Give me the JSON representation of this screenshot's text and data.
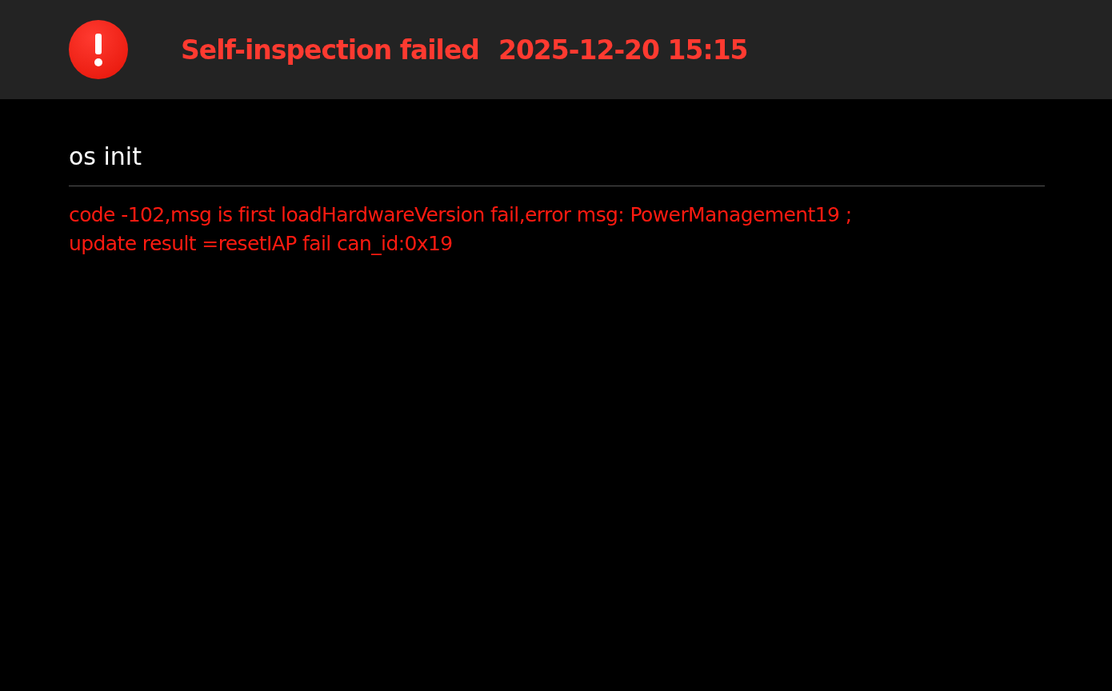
{
  "header": {
    "kind": "error",
    "title": "Self-inspection failed",
    "time": "2025-12-20 15:15"
  },
  "section": {
    "title": "os init",
    "messages": [
      {
        "text": "code -102,msg is first loadHardwareVersion fail,error msg: PowerManagement19 ;",
        "kind": "error"
      },
      {
        "text": "update result =resetIAP fail can_id:0x19",
        "kind": "error"
      }
    ]
  }
}
